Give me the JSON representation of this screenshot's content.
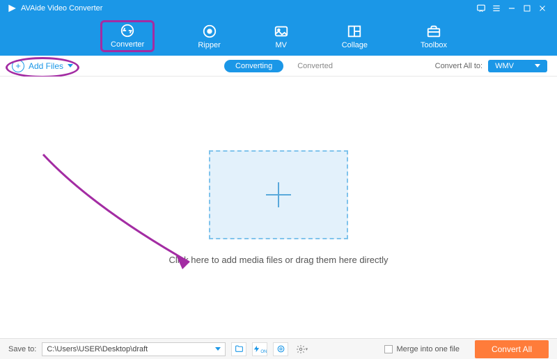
{
  "app": {
    "title": "AVAide Video Converter"
  },
  "nav": {
    "converter": "Converter",
    "ripper": "Ripper",
    "mv": "MV",
    "collage": "Collage",
    "toolbox": "Toolbox"
  },
  "subbar": {
    "add_files": "Add Files",
    "converting": "Converting",
    "converted": "Converted",
    "convert_all_to": "Convert All to:",
    "format": "WMV"
  },
  "main": {
    "drop_text": "Click here to add media files or drag them here directly"
  },
  "footer": {
    "save_to_label": "Save to:",
    "save_path": "C:\\Users\\USER\\Desktop\\draft",
    "merge_label": "Merge into one file",
    "convert_all": "Convert All"
  }
}
